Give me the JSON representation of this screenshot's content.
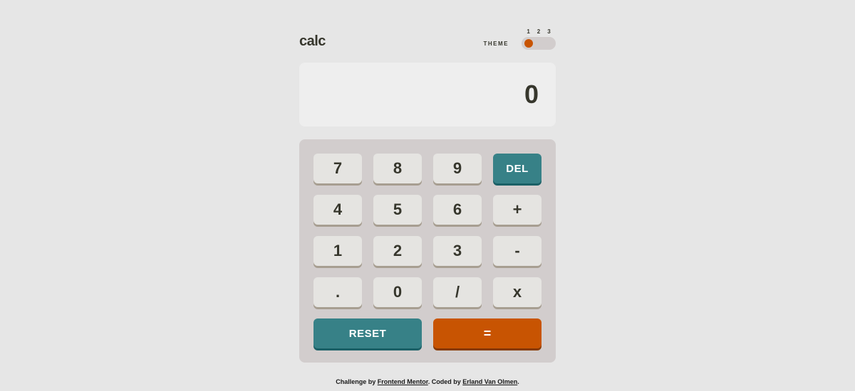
{
  "app": {
    "title": "calc",
    "theme_label": "THEME",
    "theme_options": {
      "one": "1",
      "two": "2",
      "three": "3"
    },
    "theme_selected": 1
  },
  "display": {
    "value": "0"
  },
  "keys": {
    "seven": "7",
    "eight": "8",
    "nine": "9",
    "del": "DEL",
    "four": "4",
    "five": "5",
    "six": "6",
    "plus": "+",
    "one": "1",
    "two": "2",
    "three": "3",
    "minus": "-",
    "dot": ".",
    "zero": "0",
    "divide": "/",
    "multiply": "x",
    "reset": "RESET",
    "equals": "="
  },
  "attribution": {
    "prefix": "Challenge by ",
    "link1": "Frontend Mentor",
    "middle": ". Coded by ",
    "link2": "Erland Van Olmen",
    "suffix": "."
  }
}
